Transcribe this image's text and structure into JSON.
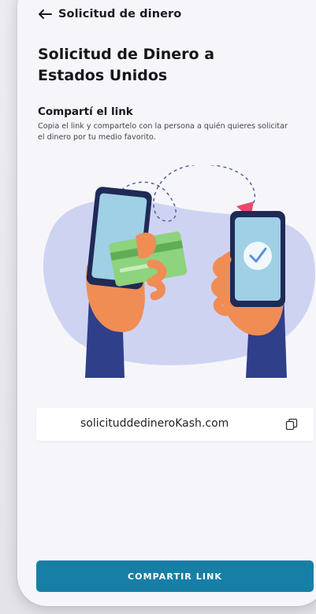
{
  "header": {
    "title": "Solicitud de dinero",
    "back_icon": "arrow-left-icon"
  },
  "main": {
    "title": "Solicitud de Dinero a Estados Unidos",
    "section_title": "Compartí el link",
    "section_description": "Copia el link  y compartelo con la persona a quién quieres solicitar el dinero por tu medio favorito."
  },
  "illustration": {
    "icon": "phone-to-phone-transfer-illustration"
  },
  "link": {
    "value": "solicituddedineroKash.com",
    "copy_icon": "copy-icon"
  },
  "actions": {
    "share_label": "COMPARTIR LINK"
  },
  "colors": {
    "primary": "#177fa6",
    "blob": "#cfd3f2",
    "skin": "#f08d55",
    "phone_screen": "#9fd0e6",
    "card": "#8ed37d",
    "arrow": "#e94a6b"
  }
}
